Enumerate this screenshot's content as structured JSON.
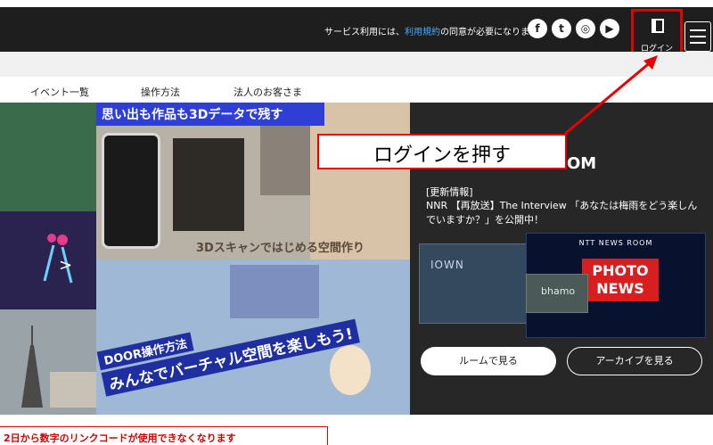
{
  "header": {
    "notice_prefix": "サービス利用には、",
    "notice_link": "利用規約",
    "notice_suffix": "の同意が必要になります。",
    "social_icons": [
      "facebook-icon",
      "twitter-icon",
      "instagram-icon",
      "youtube-icon"
    ],
    "login_label": "ログイン",
    "menu_icon": "hamburger-menu-icon"
  },
  "nav": {
    "items": [
      "イベント一覧",
      "操作方法",
      "法人のお客さま"
    ]
  },
  "hero": {
    "banner_top": "思い出も作品も3Dデータで残す",
    "banner_scan": "3Dスキャンではじめる空間作り",
    "door_line1": "DOOR操作方法",
    "door_line2": "みんなでバーチャル空間を楽しもう!"
  },
  "news": {
    "heading_partial": "OM",
    "tag": "[更新情報]",
    "text": "NNR 【再放送】The Interview 「あなたは梅雨をどう楽しんでいますか？」を公開中！",
    "thumb1_logo": "IOWN",
    "thumb2_logo": "bhamo",
    "photo_caption": "NTT NEWS ROOM",
    "photo_title_line1": "PHOTO",
    "photo_title_line2": "NEWS",
    "btn_room": "ルームで見る",
    "btn_archive": "アーカイブを見る"
  },
  "notice": {
    "text": "2日から数字のリンクコードが使用できなくなります"
  },
  "annotation": {
    "callout_text": "ログインを押す",
    "color": "#e30000"
  },
  "colors": {
    "header_bg": "#1e1e1e",
    "accent_red": "#e30000",
    "news_bg": "#272727",
    "banner_blue": "#2f3fd6"
  }
}
